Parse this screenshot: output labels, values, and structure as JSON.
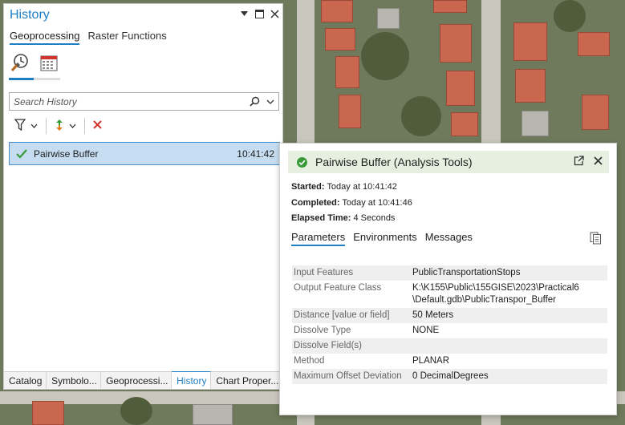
{
  "history_pane": {
    "title": "History",
    "subtabs": [
      "Geoprocessing",
      "Raster Functions"
    ],
    "icons": [
      "history-clock-icon",
      "calendar-icon"
    ],
    "search": {
      "placeholder": "Search History"
    },
    "toolbar": [
      "filter-icon",
      "sort-icon",
      "delete-icon"
    ],
    "items": [
      {
        "name": "Pairwise Buffer",
        "time": "10:41:42",
        "status": "success"
      }
    ],
    "bottom_tabs": [
      "Catalog",
      "Symbolo...",
      "Geoprocessi...",
      "History",
      "Chart Proper..."
    ],
    "active_bottom_tab": "History"
  },
  "details": {
    "title": "Pairwise Buffer (Analysis Tools)",
    "started_label": "Started:",
    "started_value": "Today at 10:41:42",
    "completed_label": "Completed:",
    "completed_value": "Today at 10:41:46",
    "elapsed_label": "Elapsed Time:",
    "elapsed_value": "4 Seconds",
    "tabs": [
      "Parameters",
      "Environments",
      "Messages"
    ],
    "active_tab": "Parameters",
    "parameters": [
      {
        "name": "Input Features",
        "value": "PublicTransportationStops"
      },
      {
        "name": "Output Feature Class",
        "value": "K:\\K155\\Public\\155GISE\\2023\\Practical6 \\Default.gdb\\PublicTranspor_Buffer"
      },
      {
        "name": "Distance [value or field]",
        "value": "50 Meters"
      },
      {
        "name": "Dissolve Type",
        "value": "NONE"
      },
      {
        "name": "Dissolve Field(s)",
        "value": ""
      },
      {
        "name": "Method",
        "value": "PLANAR"
      },
      {
        "name": "Maximum Offset Deviation",
        "value": "0 DecimalDegrees"
      }
    ]
  },
  "colors": {
    "accent": "#1f7fc4",
    "success": "#3a9a3a",
    "delete": "#d0342c",
    "selected_row": "#c6ddf1",
    "header_bg": "#e6f0e1"
  }
}
